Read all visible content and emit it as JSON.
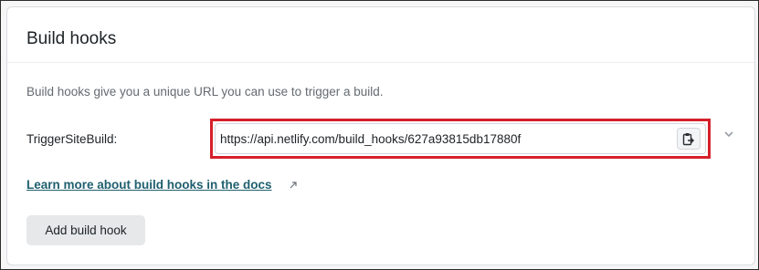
{
  "section": {
    "title": "Build hooks",
    "description": "Build hooks give you a unique URL you can use to trigger a build."
  },
  "hook": {
    "name": "TriggerSiteBuild:",
    "url": "https://api.netlify.com/build_hooks/627a93815db17880f"
  },
  "links": {
    "learn_more": "Learn more about build hooks in the docs"
  },
  "actions": {
    "add_build_hook": "Add build hook"
  },
  "icons": {
    "copy": "copy-to-clipboard-icon",
    "expand": "chevron-down-icon",
    "external": "external-link-icon"
  },
  "colors": {
    "highlight": "#d6202b",
    "link": "#1f5f6e"
  }
}
